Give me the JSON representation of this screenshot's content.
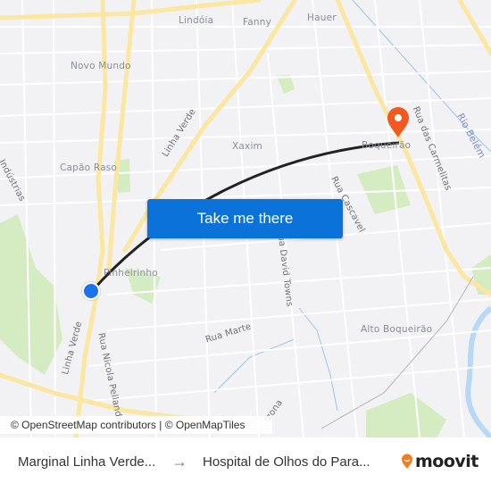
{
  "map": {
    "neighborhoods": [
      {
        "id": "lindoia",
        "label": "Lindóia"
      },
      {
        "id": "fanny",
        "label": "Fanny"
      },
      {
        "id": "hauer",
        "label": "Hauer"
      },
      {
        "id": "novo-mundo",
        "label": "Novo Mundo"
      },
      {
        "id": "xaxim",
        "label": "Xaxim"
      },
      {
        "id": "capao-raso",
        "label": "Capão Raso"
      },
      {
        "id": "boqueirao",
        "label": "Boqueirão"
      },
      {
        "id": "pinheirinho",
        "label": "Pinheirinho"
      },
      {
        "id": "alto-boqueirao",
        "label": "Alto Boqueirão"
      }
    ],
    "streets": [
      {
        "id": "linha-verde-north",
        "label": "Linha Verde"
      },
      {
        "id": "linha-verde-south",
        "label": "Linha Verde"
      },
      {
        "id": "rua-das-carmelitas",
        "label": "Rua das Carmelitas"
      },
      {
        "id": "rua-cascavel",
        "label": "Rua Cascavel"
      },
      {
        "id": "rua-david-towns",
        "label": "Rua David Towns"
      },
      {
        "id": "rua-marte",
        "label": "Rua Marte"
      },
      {
        "id": "rua-nicola-pellanda",
        "label": "Rua Nicola Pellanda"
      },
      {
        "id": "industrias",
        "label": "Indústrias"
      },
      {
        "id": "zona",
        "label": "zona"
      },
      {
        "id": "rio-belem",
        "label": "Rio Belém"
      }
    ],
    "cta_label": "Take me there",
    "attribution": "© OpenStreetMap contributors | © OpenMapTiles",
    "colors": {
      "route": "#222222",
      "origin": "#1a73e8",
      "destination": "#f05a1e",
      "cta": "#0b72d9",
      "major_road": "#fbe7a1",
      "park": "#d5ecc3",
      "water": "#b7d9f5"
    }
  },
  "footer": {
    "origin": "Marginal Linha Verde...",
    "arrow": "→",
    "destination": "Hospital de Olhos do Para...",
    "brand": "moovit"
  }
}
